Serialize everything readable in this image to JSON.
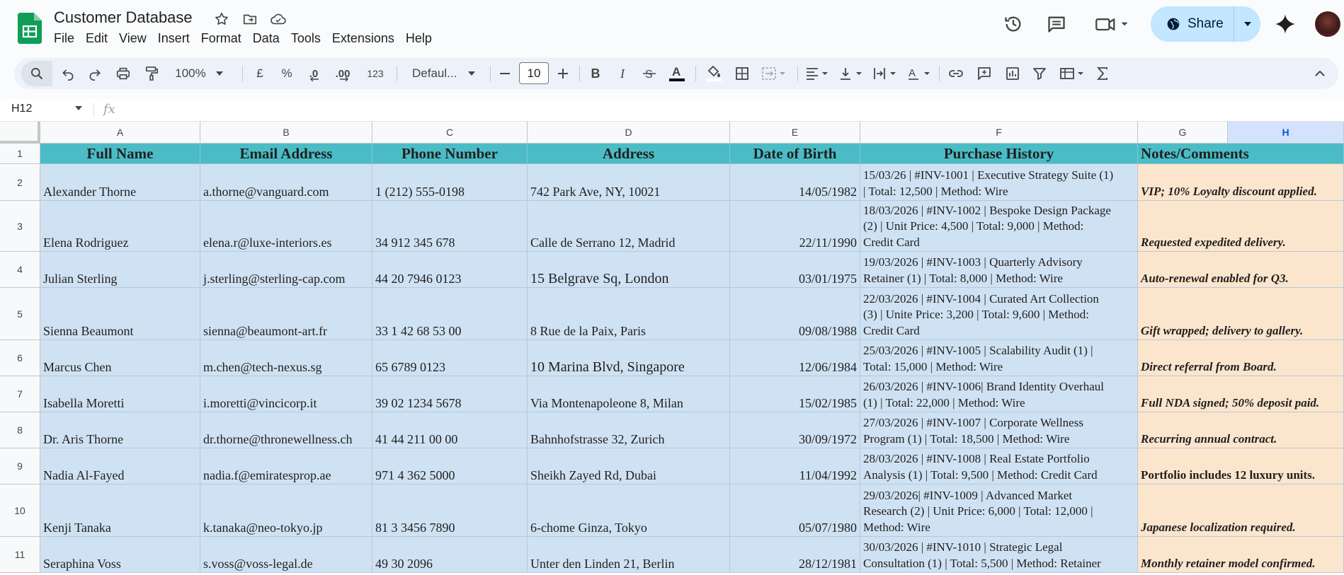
{
  "app": {
    "title": "Customer Database",
    "menus": [
      "File",
      "Edit",
      "View",
      "Insert",
      "Format",
      "Data",
      "Tools",
      "Extensions",
      "Help"
    ],
    "share_label": "Share"
  },
  "toolbar": {
    "zoom": "100%",
    "currency": "£",
    "percent": "%",
    "dec_decrease": ".0",
    "dec_increase": ".00",
    "number_format": "123",
    "font": "Defaul...",
    "font_size": "10"
  },
  "formula_bar": {
    "cell_ref": "H12",
    "fx": "fx",
    "content": ""
  },
  "columns": [
    "A",
    "B",
    "C",
    "D",
    "E",
    "F",
    "G",
    "H"
  ],
  "selected_column": "H",
  "header_row": {
    "row_number": "1",
    "full_name": "Full Name",
    "email": "Email Address",
    "phone": "Phone Number",
    "address": "Address",
    "dob": "Date of Birth",
    "history": "Purchase History",
    "notes": "Notes/Comments"
  },
  "rows": [
    {
      "n": "2",
      "name": "Alexander Thorne",
      "email": "a.thorne@vanguard.com",
      "phone": "1 (212) 555-0198",
      "address": "742 Park Ave, NY, 10021",
      "dob": "14/05/1982",
      "history": [
        "15/03/26 | #INV-1001 | Executive Strategy Suite (1)",
        "| Total: 12,500 | Method: Wire"
      ],
      "notes": "VIP; 10% Loyalty discount applied."
    },
    {
      "n": "3",
      "name": "Elena Rodriguez",
      "email": "elena.r@luxe-interiors.es",
      "phone": "34 912 345 678",
      "address": "Calle de Serrano 12, Madrid",
      "dob": "22/11/1990",
      "history": [
        "18/03/2026 | #INV-1002 | Bespoke Design Package",
        "(2) | Unit Price: 4,500 | Total: 9,000 | Method:",
        "Credit Card"
      ],
      "notes": "Requested expedited delivery."
    },
    {
      "n": "4",
      "name": "Julian Sterling",
      "email": "j.sterling@sterling-cap.com",
      "phone": "44 20 7946 0123",
      "address": "15 Belgrave Sq, London",
      "dob": "03/01/1975",
      "history": [
        "19/03/2026 | #INV-1003 | Quarterly Advisory",
        "Retainer (1) | Total: 8,000 | Method: Wire"
      ],
      "notes": "Auto-renewal enabled for Q3."
    },
    {
      "n": "5",
      "name": "Sienna Beaumont",
      "email": "sienna@beaumont-art.fr",
      "phone": "33 1 42 68 53 00",
      "address": "8 Rue de la Paix, Paris",
      "dob": "09/08/1988",
      "history": [
        "22/03/2026 | #INV-1004 | Curated Art Collection",
        "(3) | Unite Price: 3,200 | Total: 9,600 | Method:",
        "Credit Card"
      ],
      "notes": "Gift wrapped; delivery to gallery."
    },
    {
      "n": "6",
      "name": "Marcus Chen",
      "email": "m.chen@tech-nexus.sg",
      "phone": "65 6789 0123",
      "address": "10 Marina Blvd, Singapore",
      "dob": "12/06/1984",
      "history": [
        "25/03/2026 | #INV-1005 | Scalability Audit (1) |",
        "Total: 15,000 | Method: Wire"
      ],
      "notes": "Direct referral from Board."
    },
    {
      "n": "7",
      "name": "Isabella Moretti",
      "email": "i.moretti@vincicorp.it",
      "phone": "39 02 1234 5678",
      "address": "Via Montenapoleone 8, Milan",
      "dob": "15/02/1985",
      "history": [
        "26/03/2026 | #INV-1006| Brand Identity Overhaul",
        "(1) | Total: 22,000 | Method: Wire"
      ],
      "notes": "Full NDA signed; 50% deposit paid."
    },
    {
      "n": "8",
      "name": "Dr. Aris Thorne",
      "email": "dr.thorne@thronewellness.ch",
      "phone": "41 44 211 00 00",
      "address": "Bahnhofstrasse 32, Zurich",
      "dob": "30/09/1972",
      "history": [
        "27/03/2026 | #INV-1007 | Corporate Wellness",
        "Program (1) | Total: 18,500 | Method: Wire"
      ],
      "notes": "Recurring annual contract."
    },
    {
      "n": "9",
      "name": "Nadia Al-Fayed",
      "email": "nadia.f@emiratesprop.ae",
      "phone": "971 4 362 5000",
      "address": "Sheikh Zayed Rd, Dubai",
      "dob": "11/04/1992",
      "history": [
        "28/03/2026 | #INV-1008 | Real Estate Portfolio",
        "Analysis (1) | Total: 9,500 | Method: Credit Card"
      ],
      "notes": "Portfolio includes 12 luxury units."
    },
    {
      "n": "10",
      "name": "Kenji Tanaka",
      "email": "k.tanaka@neo-tokyo.jp",
      "phone": "81 3 3456 7890",
      "address": "6-chome Ginza, Tokyo",
      "dob": "05/07/1980",
      "history": [
        "29/03/2026| #INV-1009 | Advanced Market",
        "Research (2) | Unit Price: 6,000 | Total: 12,000 |",
        "Method: Wire"
      ],
      "notes": "Japanese localization required."
    },
    {
      "n": "11",
      "name": "Seraphina Voss",
      "email": "s.voss@voss-legal.de",
      "phone": "49 30 2096",
      "address": "Unter den Linden 21, Berlin",
      "dob": "28/12/1981",
      "history": [
        "30/03/2026 | #INV-1010 | Strategic Legal",
        "Consultation (1) | Total: 5,500 | Method: Retainer"
      ],
      "notes": "Monthly retainer model confirmed."
    }
  ]
}
